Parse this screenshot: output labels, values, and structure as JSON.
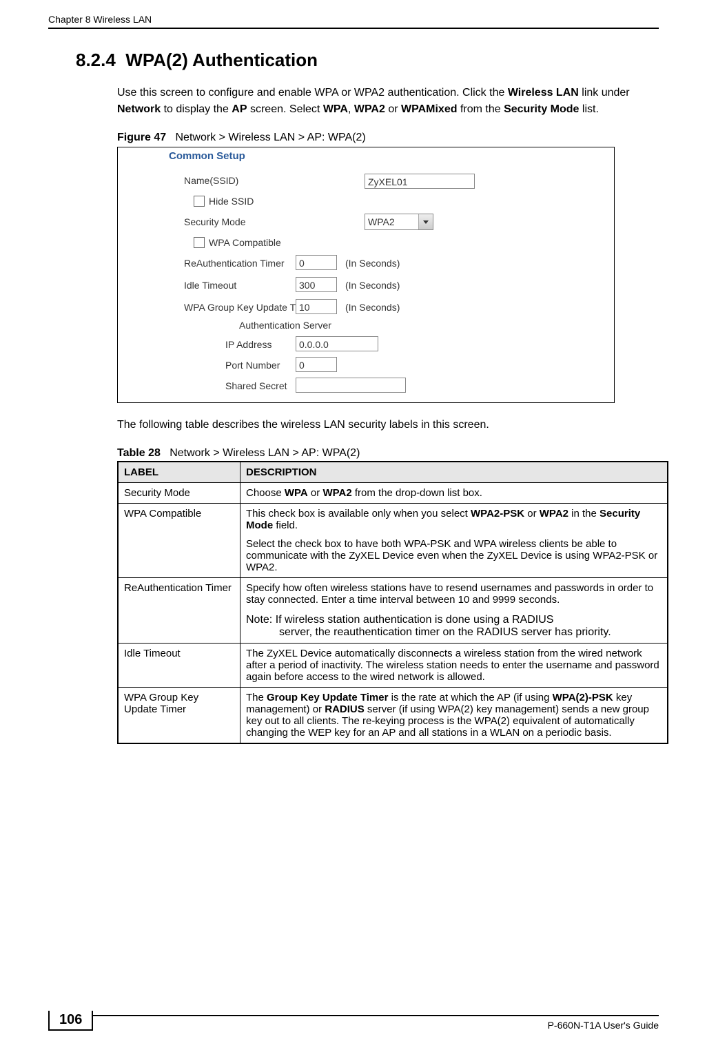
{
  "header": {
    "chapter": "Chapter 8 Wireless LAN"
  },
  "section": {
    "number": "8.2.4",
    "title": "WPA(2) Authentication"
  },
  "intro": {
    "p1_a": "Use this screen to configure and enable WPA or WPA2 authentication. Click the ",
    "p1_b": "Wireless LAN",
    "p1_c": " link under ",
    "p1_d": "Network",
    "p1_e": " to display the ",
    "p1_f": "AP",
    "p1_g": " screen. Select ",
    "p1_h": "WPA",
    "p1_i": ", ",
    "p1_j": "WPA2",
    "p1_k": " or ",
    "p1_l": "WPAMixed",
    "p1_m": " from the ",
    "p1_n": "Security Mode",
    "p1_o": " list."
  },
  "figure": {
    "caption_label": "Figure 47",
    "caption_text": "Network > Wireless LAN > AP: WPA(2)",
    "panel_title": "Common Setup",
    "labels": {
      "name_ssid": "Name(SSID)",
      "hide_ssid": "Hide SSID",
      "security_mode": "Security Mode",
      "wpa_compatible": "WPA Compatible",
      "reauth_timer": "ReAuthentication Timer",
      "idle_timeout": "Idle Timeout",
      "wpa_group_key": "WPA Group Key Update Timer",
      "auth_server": "Authentication Server",
      "ip_address": "IP Address",
      "port_number": "Port Number",
      "shared_secret": "Shared Secret",
      "seconds_unit": "(In Seconds)"
    },
    "values": {
      "ssid": "ZyXEL01",
      "security_mode": "WPA2",
      "reauth_timer": "0",
      "idle_timeout": "300",
      "wpa_group_key": "10",
      "ip_address": "0.0.0.0",
      "port_number": "0",
      "shared_secret": ""
    }
  },
  "transition_text": "The following table describes the wireless LAN security labels in this screen.",
  "table": {
    "caption_label": "Table 28",
    "caption_text": "Network > Wireless LAN > AP: WPA(2)",
    "headers": {
      "label": "LABEL",
      "description": "DESCRIPTION"
    },
    "rows": [
      {
        "label": "Security Mode",
        "desc_a": "Choose ",
        "desc_b": "WPA",
        "desc_c": " or ",
        "desc_d": "WPA2",
        "desc_e": " from the drop-down list box."
      },
      {
        "label": "WPA Compatible",
        "p1_a": "This check box is available only when you select ",
        "p1_b": "WPA2-PSK",
        "p1_c": " or ",
        "p1_d": "WPA2",
        "p1_e": " in the ",
        "p1_f": "Security Mode",
        "p1_g": " field.",
        "p2": "Select the check box to have both WPA-PSK and WPA wireless clients be able to communicate with the ZyXEL Device even when the ZyXEL Device is using WPA2-PSK or WPA2."
      },
      {
        "label": "ReAuthentication Timer",
        "p1": "Specify how often wireless stations have to resend usernames and passwords in order to stay connected. Enter a time interval between 10 and 9999 seconds.",
        "note_prefix": "Note: ",
        "note_line1": "If wireless station authentication is done using a RADIUS",
        "note_line2": "server, the reauthentication timer on the RADIUS server has priority."
      },
      {
        "label": "Idle Timeout",
        "p1": "The ZyXEL Device automatically disconnects a wireless station from the wired network after a period of inactivity. The wireless station needs to enter the username and password again before access to the wired network is allowed."
      },
      {
        "label": "WPA Group Key Update Timer",
        "p1_a": "The ",
        "p1_b": "Group Key Update Timer",
        "p1_c": " is the rate at which the AP (if using ",
        "p1_d": "WPA(2)-PSK",
        "p1_e": " key management) or ",
        "p1_f": "RADIUS",
        "p1_g": " server (if using WPA(2) key management) sends a new group key out to all clients. The re-keying process is the WPA(2) equivalent of automatically changing the WEP key for an AP and all stations in a WLAN on a periodic basis."
      }
    ]
  },
  "footer": {
    "page_number": "106",
    "guide": "P-660N-T1A User's Guide"
  }
}
